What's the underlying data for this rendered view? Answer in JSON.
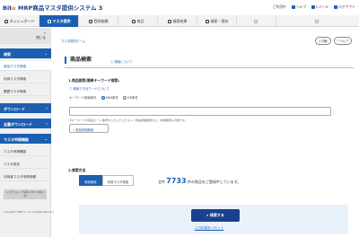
{
  "header": {
    "logo_main": "Bit",
    "logo_mark": "e",
    "logo_suffix": "MRP商品マスタ提供システム",
    "logo_num": "3",
    "account_text": "ご利用中",
    "help_label": "ヘルプ",
    "myinfo_label": "Eメール",
    "logout_label": "ログアウト"
  },
  "nav": {
    "items": [
      {
        "label": "ダッシュボード",
        "state": "normal"
      },
      {
        "label": "マスタ提供",
        "state": "active"
      },
      {
        "label": "登録依頼",
        "state": "normal"
      },
      {
        "label": "商品",
        "state": "normal"
      },
      {
        "label": "検索結果",
        "state": "normal"
      },
      {
        "label": "検索・保存",
        "state": "normal"
      },
      {
        "label": "",
        "state": "disabled"
      },
      {
        "label": "",
        "state": "disabled"
      }
    ]
  },
  "sidebar": {
    "collapse_label": "閉じる",
    "section_search": "検索",
    "link_product_search": "商品マスタ検索",
    "link_usage_search": "利用マスタ検索",
    "link_history": "履歴マスタ検索",
    "section_download": "ダウンロード",
    "section_bulk_download": "全量ダウンロード",
    "section_master_config": "マスタ申請機能",
    "link_master_confirm": "マスタ申請確認",
    "link_master_setting": "マスタ設定",
    "link_update_settings": "利用者マスタ申請依頼",
    "badge_text": "システムメンテ情報 (PDF 1MB以内)",
    "copyright": "Copyright © MRP Co., Ltd. All Rights Reserved."
  },
  "main": {
    "breadcrumb": "マスタ提供ホーム",
    "btn_print": "印刷",
    "btn_help": "ヘルプ",
    "page_title": "商品検索",
    "info_link": "検索について",
    "section1_title": "1.商品検索(簡単キーワード検索)",
    "keyword_hint": "検索できるワードについて",
    "keyword_label": "キーワード検索条件",
    "radio_and": "AND条件",
    "radio_or": "OR条件",
    "keyword_value": "",
    "note_text": "※キーワードや部品コード番号を入力してください。商品詳細検索から、詳細検索も可能です。",
    "detail_button": "商品詳細検索",
    "section2_title": "2.検索方法",
    "tab_product": "商品検索",
    "tab_usage": "利用マスタ検索",
    "count_prefix": "全件",
    "count_value": "7733",
    "count_suffix": "件の商品をご登録中しています。",
    "search_button": "検索する",
    "reset_link": "入力内容をリセット"
  },
  "colors": {
    "accent": "#1c5fb2",
    "brand_dark": "#1c3f8f",
    "panel_bg": "#e9f1fb"
  }
}
